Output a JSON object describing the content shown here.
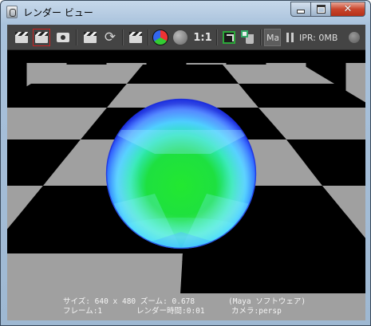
{
  "window": {
    "title": "レンダー ビュー",
    "controls": {
      "minimize": "minimize",
      "maximize": "maximize",
      "close": "✕"
    }
  },
  "toolbar": {
    "icons": [
      "render-clapper-icon",
      "render-region-icon",
      "snapshot-camera-icon",
      "render-sequence-icon",
      "refresh-icon",
      "ipr-render-icon",
      "rgb-channels-icon",
      "alpha-channel-icon",
      "keep-image-icon",
      "remove-image-icon"
    ],
    "ratio_label": "1:1",
    "maya_label": "Maya",
    "ipr_status": "IPR: 0MB"
  },
  "viewport": {
    "colors": {
      "floor_light": "#a0a0a0",
      "floor_dark": "#000000",
      "sphere_core": "#1fe030",
      "sphere_rim": "#2a4cff",
      "sphere_glass": "#66d8ff"
    }
  },
  "status": {
    "line1_left": "サイズ: 640 x 480 ズーム: 0.678",
    "line1_right": "(Maya ソフトウェア)",
    "line2_frame": "フレーム:1",
    "line2_time": "レンダー時間:0:01",
    "line2_camera": "カメラ:persp"
  }
}
